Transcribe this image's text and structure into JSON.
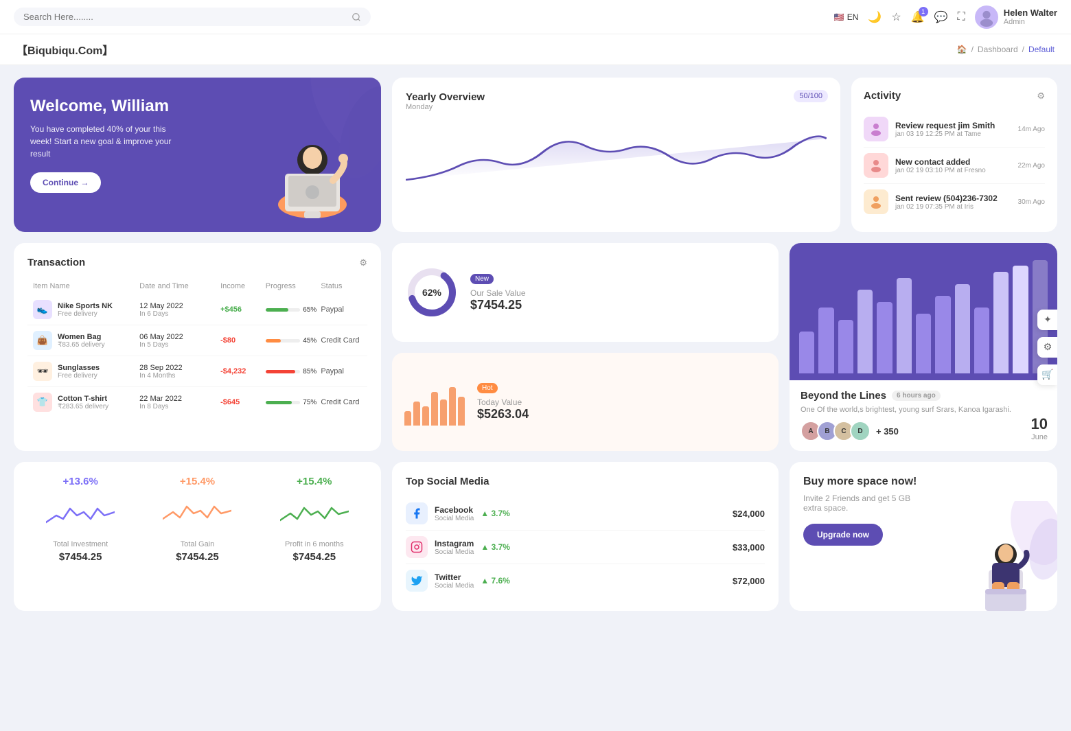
{
  "topnav": {
    "search_placeholder": "Search Here........",
    "lang": "EN",
    "user_name": "Helen Walter",
    "user_role": "Admin",
    "notification_count": "1"
  },
  "breadcrumb": {
    "brand": "【Biqubiqu.Com】",
    "home": "Home",
    "dashboard": "Dashboard",
    "current": "Default"
  },
  "welcome": {
    "title": "Welcome, William",
    "subtitle": "You have completed 40% of your this week! Start a new goal & improve your result",
    "button": "Continue →"
  },
  "yearly": {
    "title": "Yearly Overview",
    "subtitle": "Monday",
    "badge": "50/100"
  },
  "activity": {
    "title": "Activity",
    "items": [
      {
        "title": "Review request jim Smith",
        "detail": "jan 03 19 12:25 PM at Tame",
        "time": "14m Ago",
        "color": "#e8d5f5"
      },
      {
        "title": "New contact added",
        "detail": "jan 02 19 03:10 PM at Fresno",
        "time": "22m Ago",
        "color": "#ffd5d5"
      },
      {
        "title": "Sent review (504)236-7302",
        "detail": "jan 02 19 07:35 PM at Iris",
        "time": "30m Ago",
        "color": "#fdebd0"
      }
    ]
  },
  "transaction": {
    "title": "Transaction",
    "columns": [
      "Item Name",
      "Date and Time",
      "Income",
      "Progress",
      "Status"
    ],
    "rows": [
      {
        "name": "Nike Sports NK",
        "sub": "Free delivery",
        "date": "12 May 2022",
        "period": "In 6 Days",
        "income": "+$456",
        "positive": true,
        "progress": 65,
        "progress_color": "#4caf50",
        "status": "Paypal",
        "icon_color": "#e8e0ff"
      },
      {
        "name": "Women Bag",
        "sub": "₹83.65 delivery",
        "date": "06 May 2022",
        "period": "In 5 Days",
        "income": "-$80",
        "positive": false,
        "progress": 45,
        "progress_color": "#ff8c42",
        "status": "Credit Card",
        "icon_color": "#e0f0ff"
      },
      {
        "name": "Sunglasses",
        "sub": "Free delivery",
        "date": "28 Sep 2022",
        "period": "In 4 Months",
        "income": "-$4,232",
        "positive": false,
        "progress": 85,
        "progress_color": "#f44336",
        "status": "Paypal",
        "icon_color": "#fff0e0"
      },
      {
        "name": "Cotton T-shirt",
        "sub": "₹283.65 delivery",
        "date": "22 Mar 2022",
        "period": "In 8 Days",
        "income": "-$645",
        "positive": false,
        "progress": 75,
        "progress_color": "#4caf50",
        "status": "Credit Card",
        "icon_color": "#ffe0e0"
      }
    ]
  },
  "sale_value": {
    "badge": "New",
    "percentage": "62%",
    "label": "Our Sale Value",
    "value": "$7454.25"
  },
  "today_value": {
    "badge": "Hot",
    "label": "Today Value",
    "value": "$5263.04"
  },
  "beyond": {
    "title": "Beyond the Lines",
    "time_ago": "6 hours ago",
    "description": "One Of the world,s brightest, young surf Srars, Kanoa Igarashi.",
    "plus_count": "+ 350",
    "date_num": "10",
    "date_mon": "June"
  },
  "stats": [
    {
      "pct": "+13.6%",
      "label": "Total Investment",
      "value": "$7454.25",
      "color": "#7c6ff7"
    },
    {
      "pct": "+15.4%",
      "label": "Total Gain",
      "value": "$7454.25",
      "color": "#ff9966"
    },
    {
      "pct": "+15.4%",
      "label": "Profit in 6 months",
      "value": "$7454.25",
      "color": "#4caf50"
    }
  ],
  "social": {
    "title": "Top Social Media",
    "items": [
      {
        "name": "Facebook",
        "type": "Social Media",
        "pct": "3.7%",
        "value": "$24,000",
        "color": "#1877f2",
        "icon": "f"
      },
      {
        "name": "Instagram",
        "type": "Social Media",
        "pct": "3.7%",
        "value": "$33,000",
        "color": "#e1306c",
        "icon": "📷"
      },
      {
        "name": "Twitter",
        "type": "Social Media",
        "pct": "7.6%",
        "value": "$72,000",
        "color": "#1da1f2",
        "icon": "t"
      }
    ]
  },
  "buy_space": {
    "title": "Buy more space now!",
    "description": "Invite 2 Friends and get 5 GB extra space.",
    "button": "Upgrade now"
  }
}
